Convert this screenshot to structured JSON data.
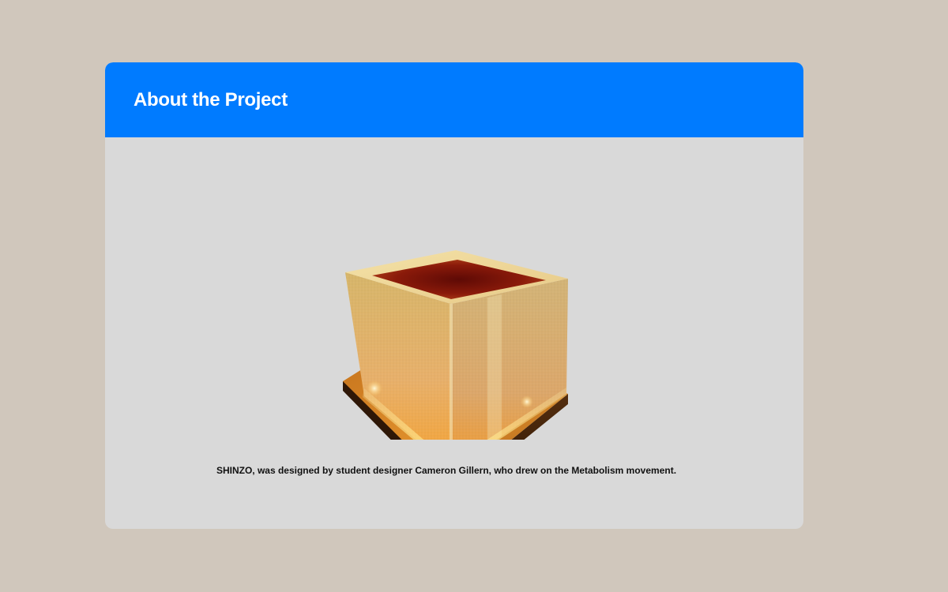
{
  "header": {
    "title": "About the Project"
  },
  "image": {
    "icon": "glowing-cube-lamp-image",
    "alt": "SHINZO lamp"
  },
  "caption": {
    "text": "SHINZO, was designed by student designer Cameron Gillern, who drew on the Metabolism movement."
  },
  "colors": {
    "page_background": "#d0c7bc",
    "card_background": "#d9d9d9",
    "header_background": "#007bff",
    "header_text": "#ffffff",
    "caption_text": "#111111"
  }
}
